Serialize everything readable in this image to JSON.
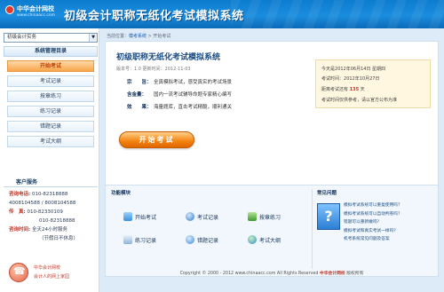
{
  "header": {
    "logo_name": "中华会计网校",
    "logo_url": "www.chinaacc.com",
    "title": "初级会计职称无纸化考试模拟系统"
  },
  "sidebar": {
    "select_value": "初级会计实务",
    "menu_title": "系统管理目录",
    "items": [
      {
        "label": "开始考试",
        "active": true
      },
      {
        "label": "考试记录"
      },
      {
        "label": "按章练习"
      },
      {
        "label": "练习记录"
      },
      {
        "label": "错题记录"
      },
      {
        "label": "考试大纲"
      }
    ],
    "customer_title": "客户服务",
    "contact": {
      "phone_label": "咨询电话:",
      "phone1": "010-82318888",
      "phone2": "4008104588 / 8008104588",
      "fax_label": "传　真:",
      "fax1": "010-82330109",
      "fax2": "010-82318888",
      "hours_label": "咨询时间:",
      "hours1": "全天24小时服务",
      "hours2": "（节假日不休息）"
    },
    "service_line1": "中华会计网校",
    "service_line2": "会计人的网上家园"
  },
  "breadcrumb": {
    "prefix": "当前位置：",
    "link": "模考系统",
    "sep": " > ",
    "current": "开始考试"
  },
  "exam": {
    "title": "初级职称无纸化考试模拟系统",
    "meta": "版本号：1.0   更新时间：2012-11-03",
    "features": [
      {
        "key": "宗　　旨：",
        "value": "全真模拟考试，感受真实的考试场景"
      },
      {
        "key": "含金量：",
        "value": "国内一流考试辅导命题专家精心编写"
      },
      {
        "key": "效　　果：",
        "value": "海量题库，直击考试精髓，顺利通关"
      }
    ],
    "start_button": "开始考试"
  },
  "info": {
    "today_prefix": "今天是",
    "today_date": "2012年06月14日 星期四",
    "exam_time_prefix": "考试时间：",
    "exam_time": "2012年10月27日",
    "countdown_prefix": "距离考试还有",
    "countdown_days": "135",
    "countdown_unit": "天",
    "notice": "考试时间仅供参考，请以官方公布为准"
  },
  "functions": {
    "title": "功能模块",
    "items": [
      {
        "label": "开始考试",
        "icon": "exam-start-icon"
      },
      {
        "label": "考试记录",
        "icon": "exam-record-icon"
      },
      {
        "label": "按章练习",
        "icon": "chapter-practice-icon"
      },
      {
        "label": "练习记录",
        "icon": "practice-record-icon"
      },
      {
        "label": "错题记录",
        "icon": "wrong-record-icon"
      },
      {
        "label": "考试大纲",
        "icon": "syllabus-icon"
      }
    ]
  },
  "faq": {
    "title": "常见问题",
    "items": [
      "模拟考试系统可以重复使用吗？",
      "模拟考试系统可以自动判卷吗？",
      "错题可以重新做吗？",
      "模拟考试和真实考试一样吗？",
      "机考系统常见问题及答案"
    ]
  },
  "footer": {
    "text": "Copyright © 2000 - 2012 www.chinaacc.com All Rights Reserved",
    "brand": "中华会计网校",
    "suffix": "版权所有"
  },
  "colors": {
    "accent": "#f2820f",
    "brand_blue": "#0c7ccf",
    "countdown_red": "#e02a1a"
  }
}
